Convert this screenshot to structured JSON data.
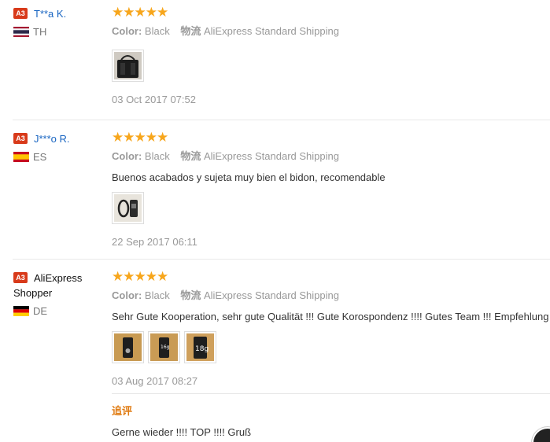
{
  "reviews": [
    {
      "level": "A3",
      "name": "T**a K.",
      "country": "TH",
      "flag": "thailand-flag",
      "rating": "★★★★★",
      "color_label": "Color:",
      "color_value": "Black",
      "shipping_label": "物流",
      "shipping_value": "AliExpress Standard Shipping",
      "text": "",
      "photos": [
        "bag-photo"
      ],
      "date": "03 Oct 2017 07:52"
    },
    {
      "level": "A3",
      "name": "J***o R.",
      "country": "ES",
      "flag": "spain-flag",
      "rating": "★★★★★",
      "color_label": "Color:",
      "color_value": "Black",
      "shipping_label": "物流",
      "shipping_value": "AliExpress Standard Shipping",
      "text": "Buenos acabados y sujeta muy bien el bidon, recomendable",
      "photos": [
        "bottle-holder-photo"
      ],
      "date": "22 Sep 2017 06:11"
    },
    {
      "level": "A3",
      "name": "AliExpress Shopper",
      "country": "DE",
      "flag": "germany-flag",
      "rating": "★★★★★",
      "color_label": "Color:",
      "color_value": "Black",
      "shipping_label": "物流",
      "shipping_value": "AliExpress Standard Shipping",
      "text": "Sehr Gute Kooperation, sehr gute Qualität !!! Gute Korospondenz !!!! Gutes Team !!! Empfehlung",
      "photos": [
        "product-photo-1",
        "product-photo-2",
        "product-photo-3"
      ],
      "photo_labels": [
        "",
        "16g",
        "18g"
      ],
      "date": "03 Aug 2017 08:27",
      "followup_title": "追评",
      "followup_text": "Gerne wieder !!!! TOP !!!! Gruß"
    }
  ]
}
